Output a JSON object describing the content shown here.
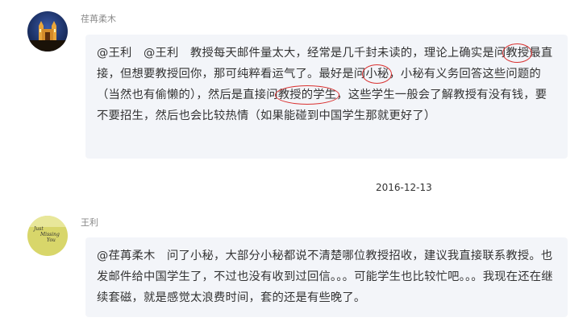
{
  "comments": [
    {
      "username": "荏苒柔木",
      "segments": [
        {
          "text": "@王利　@王利　教授每天邮件量太大，经常是几千封未读的，理论上确实是问",
          "circled": false
        },
        {
          "text": "教授",
          "circled": true
        },
        {
          "text": "最直接，但想要教授回你，那可纯粹看运气了。最好是问",
          "circled": false
        },
        {
          "text": "小秘",
          "circled": true
        },
        {
          "text": "，小秘有义务回答这些问题的（当然也有偷懒的），然后是直接问",
          "circled": false
        },
        {
          "text": "教授的学生",
          "circled": true
        },
        {
          "text": "，这些学生一般会了解教授有没有钱，要不要招生，然后也会比较热情（如果能碰到中国学生那就更好了）",
          "circled": false
        }
      ],
      "date": "2016-12-13",
      "avatar_icon": "church-night-avatar"
    },
    {
      "username": "王利",
      "segments": [
        {
          "text": "@荏苒柔木　问了小秘，大部分小秘都说不清楚哪位教授招收，建议我直接联系教授。也发邮件给中国学生了，不过也没有收到过回信。。。可能学生也比较忙吧。。。我现在还在继续套磁，就是感觉太浪费时间，套的还是有些晚了。",
          "circled": false
        }
      ],
      "avatar_icon": "yellow-note-avatar",
      "avatar_text": [
        "Just",
        "Missing",
        "You"
      ]
    }
  ],
  "colors": {
    "bubble": "#f3f5f9",
    "circle_mark": "#d9302f",
    "username": "#8a8a8a"
  }
}
